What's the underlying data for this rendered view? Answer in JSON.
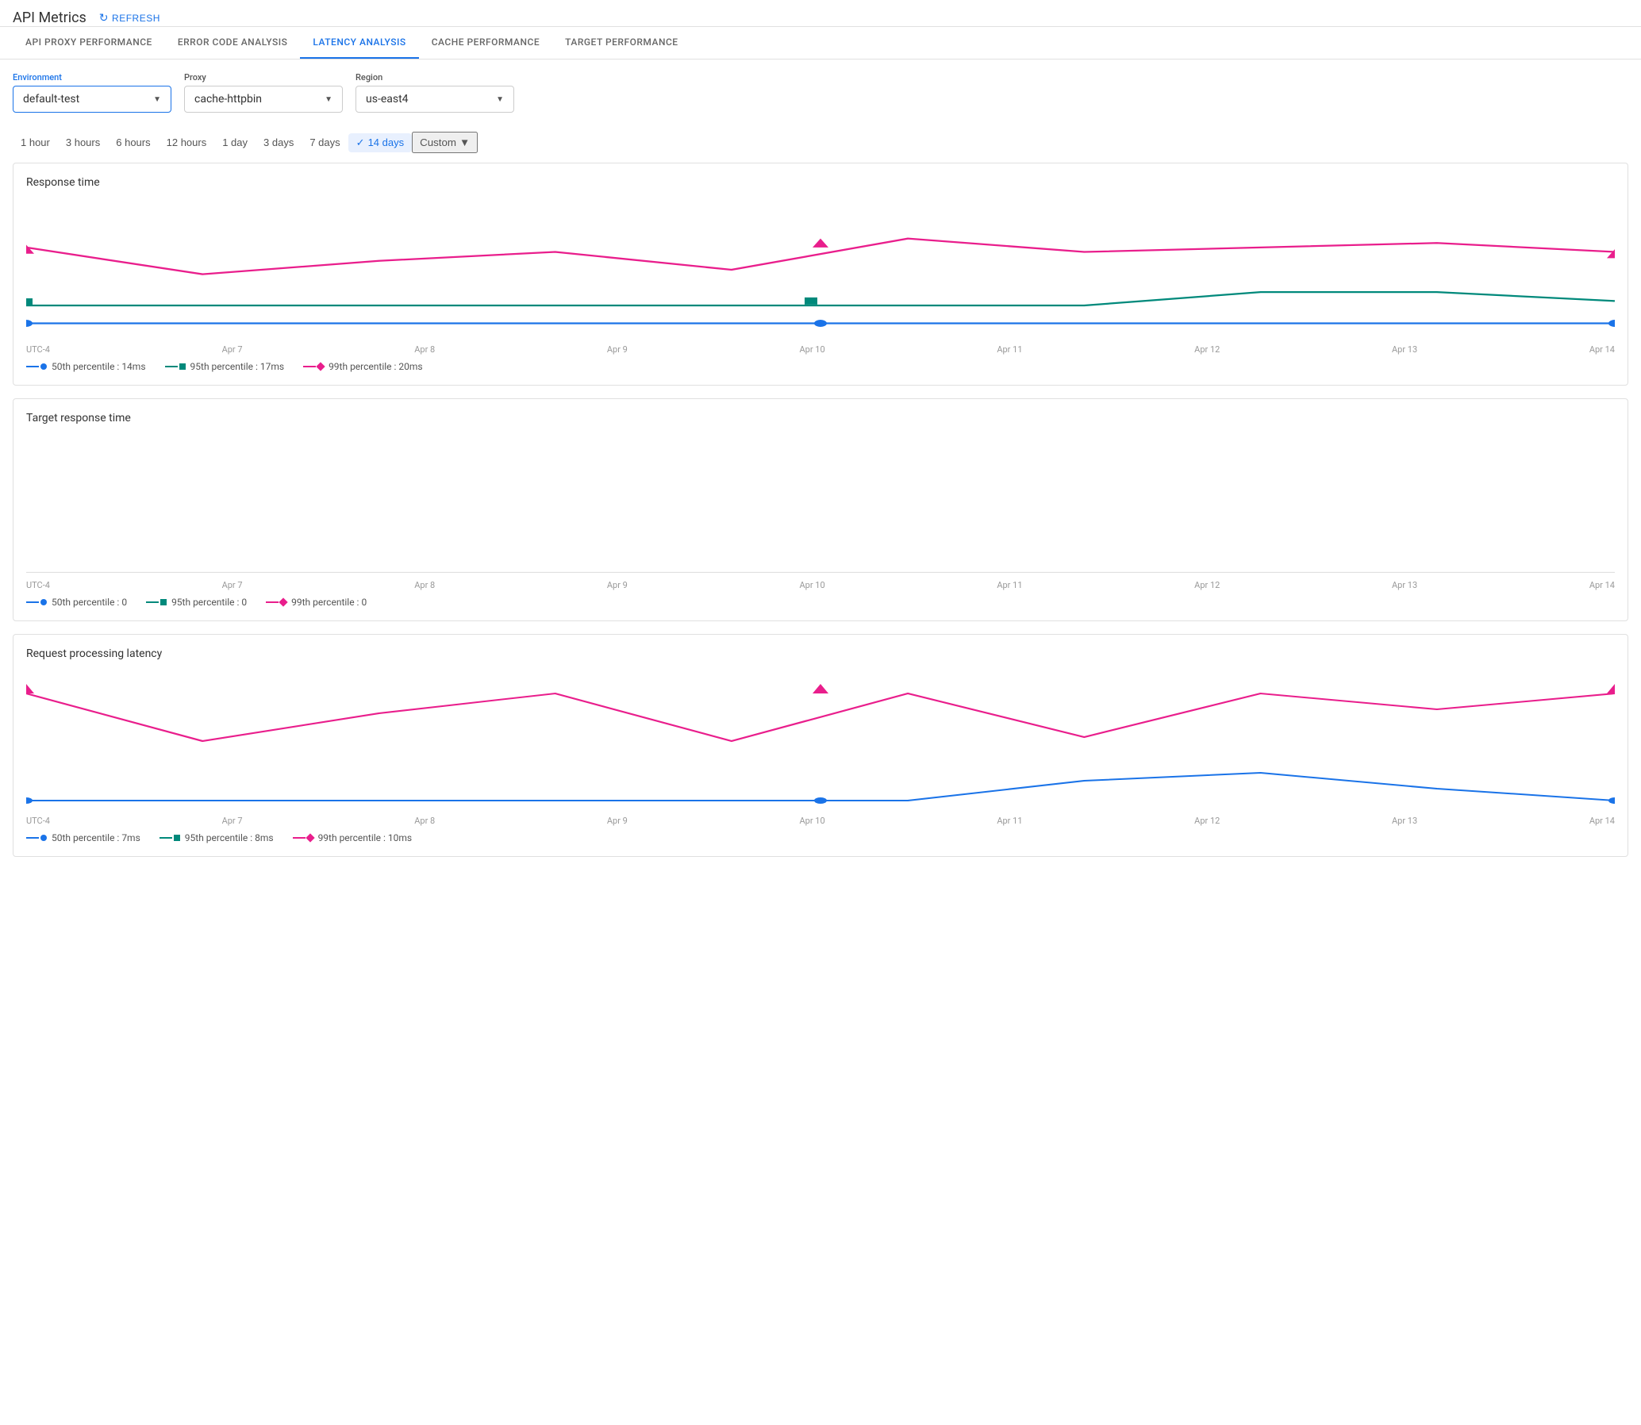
{
  "header": {
    "title": "API Metrics",
    "refresh_label": "REFRESH"
  },
  "tabs": [
    {
      "id": "api-proxy",
      "label": "API PROXY PERFORMANCE",
      "active": false
    },
    {
      "id": "error-code",
      "label": "ERROR CODE ANALYSIS",
      "active": false
    },
    {
      "id": "latency",
      "label": "LATENCY ANALYSIS",
      "active": true
    },
    {
      "id": "cache",
      "label": "CACHE PERFORMANCE",
      "active": false
    },
    {
      "id": "target",
      "label": "TARGET PERFORMANCE",
      "active": false
    }
  ],
  "filters": {
    "environment": {
      "label": "Environment",
      "value": "default-test"
    },
    "proxy": {
      "label": "Proxy",
      "value": "cache-httpbin"
    },
    "region": {
      "label": "Region",
      "value": "us-east4"
    }
  },
  "time_filters": [
    {
      "label": "1 hour",
      "active": false
    },
    {
      "label": "3 hours",
      "active": false
    },
    {
      "label": "6 hours",
      "active": false
    },
    {
      "label": "12 hours",
      "active": false
    },
    {
      "label": "1 day",
      "active": false
    },
    {
      "label": "3 days",
      "active": false
    },
    {
      "label": "7 days",
      "active": false
    },
    {
      "label": "14 days",
      "active": true
    },
    {
      "label": "Custom",
      "active": false
    }
  ],
  "charts": {
    "response_time": {
      "title": "Response time",
      "x_labels": [
        "UTC-4",
        "Apr 7",
        "Apr 8",
        "Apr 9",
        "Apr 10",
        "Apr 11",
        "Apr 12",
        "Apr 13",
        "Apr 14"
      ],
      "legend": [
        {
          "label": "50th percentile : 14ms",
          "color": "#1a73e8",
          "type": "circle"
        },
        {
          "label": "95th percentile : 17ms",
          "color": "#00897b",
          "type": "square"
        },
        {
          "label": "99th percentile : 20ms",
          "color": "#e91e8c",
          "type": "diamond"
        }
      ]
    },
    "target_response_time": {
      "title": "Target response time",
      "x_labels": [
        "UTC-4",
        "Apr 7",
        "Apr 8",
        "Apr 9",
        "Apr 10",
        "Apr 11",
        "Apr 12",
        "Apr 13",
        "Apr 14"
      ],
      "legend": [
        {
          "label": "50th percentile : 0",
          "color": "#1a73e8",
          "type": "circle"
        },
        {
          "label": "95th percentile : 0",
          "color": "#00897b",
          "type": "square"
        },
        {
          "label": "99th percentile : 0",
          "color": "#e91e8c",
          "type": "diamond"
        }
      ]
    },
    "request_processing_latency": {
      "title": "Request processing latency",
      "x_labels": [
        "UTC-4",
        "Apr 7",
        "Apr 8",
        "Apr 9",
        "Apr 10",
        "Apr 11",
        "Apr 12",
        "Apr 13",
        "Apr 14"
      ],
      "legend": [
        {
          "label": "50th percentile : 7ms",
          "color": "#1a73e8",
          "type": "circle"
        },
        {
          "label": "95th percentile : 8ms",
          "color": "#00897b",
          "type": "square"
        },
        {
          "label": "99th percentile : 10ms",
          "color": "#e91e8c",
          "type": "diamond"
        }
      ]
    }
  }
}
